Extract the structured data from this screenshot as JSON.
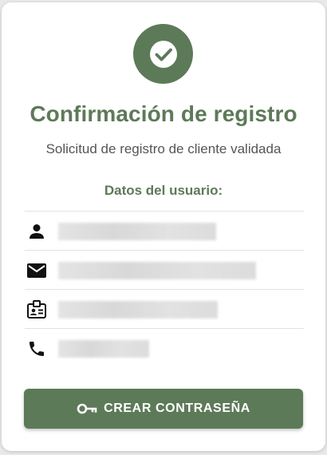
{
  "header": {
    "title": "Confirmación de registro",
    "subtitle": "Solicitud de registro de cliente validada"
  },
  "details": {
    "section_title": "Datos del usuario:",
    "items": [
      {
        "icon": "person-icon",
        "value": ""
      },
      {
        "icon": "mail-icon",
        "value": ""
      },
      {
        "icon": "id-card-icon",
        "value": ""
      },
      {
        "icon": "phone-icon",
        "value": ""
      }
    ]
  },
  "actions": {
    "create_password_label": "CREAR CONTRASEÑA",
    "create_password_icon": "key-icon"
  },
  "colors": {
    "accent": "#5d7a58",
    "text": "#555555",
    "background": "#ffffff"
  }
}
